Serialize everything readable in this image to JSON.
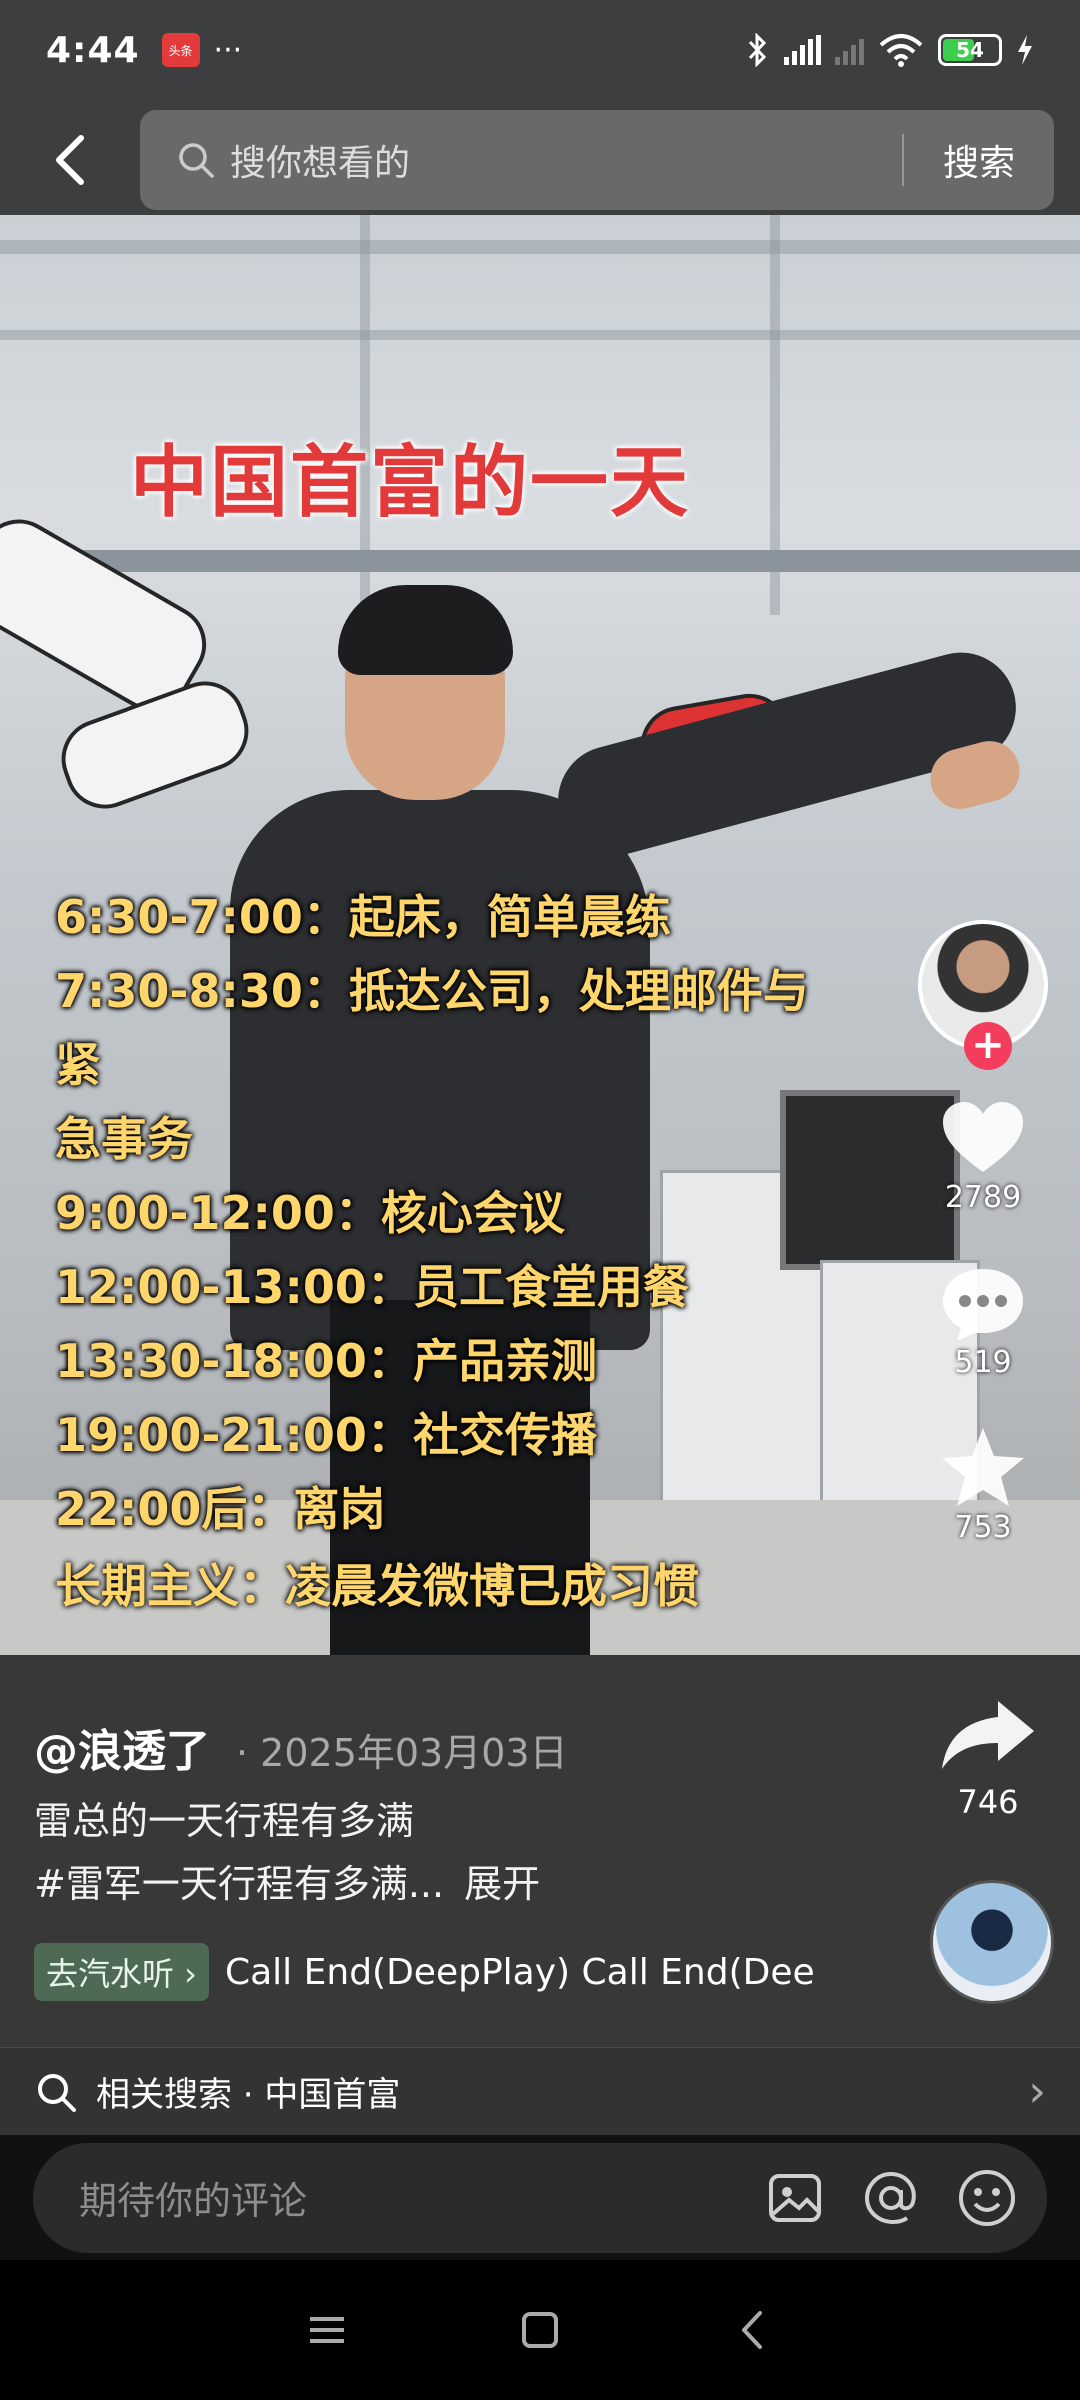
{
  "status_bar": {
    "time": "4:44",
    "app_badge": "头条",
    "more": "···",
    "battery": "54"
  },
  "header": {
    "search_placeholder": "搜你想看的",
    "search_button": "搜索"
  },
  "video": {
    "title": "中国首富的一天",
    "schedule": [
      "6:30-7:00：起床，简单晨练",
      "7:30-8:30：抵达公司，处理邮件与紧",
      "急事务",
      "9:00-12:00：核心会议",
      "12:00-13:00：员工食堂用餐",
      "13:30-18:00：产品亲测",
      "19:00-21:00：社交传播",
      "22:00后：离岗"
    ],
    "footer": "长期主义：凌晨发微博已成习惯"
  },
  "rail": {
    "likes": "2789",
    "comments": "519",
    "favorites": "753",
    "shares": "746"
  },
  "info": {
    "author": "@浪透了",
    "date": "· 2025年03月03日",
    "desc_line1": "雷总的一天行程有多满",
    "desc_line2": "#雷军一天行程有多满...",
    "expand": "展开",
    "music_tag": "去汽水听 ›",
    "music_title": "Call End(DeepPlay)    Call End(Dee",
    "related_label": "相关搜索 · 中国首富"
  },
  "comment": {
    "placeholder": "期待你的评论"
  },
  "colors": {
    "title_red": "#e23a3a",
    "schedule_yellow": "#ffd66b",
    "follow_pink": "#f23d5c",
    "music_tag_green": "#4e6a55"
  }
}
